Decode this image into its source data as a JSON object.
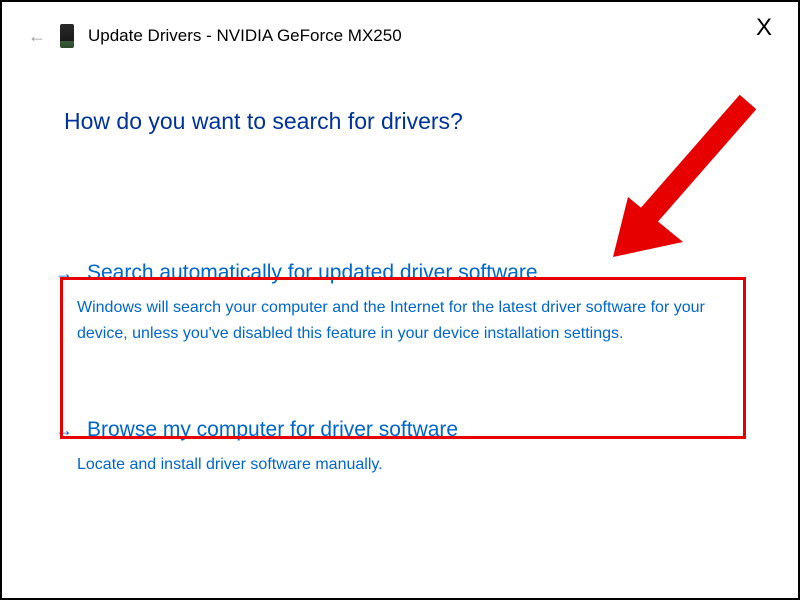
{
  "header": {
    "title": "Update Drivers - NVIDIA GeForce MX250"
  },
  "heading": "How do you want to search for drivers?",
  "options": [
    {
      "title": "Search automatically for updated driver software",
      "description": "Windows will search your computer and the Internet for the latest driver software for your device, unless you've disabled this feature in your device installation settings."
    },
    {
      "title": "Browse my computer for driver software",
      "description": "Locate and install driver software manually."
    }
  ],
  "close_label": "X"
}
